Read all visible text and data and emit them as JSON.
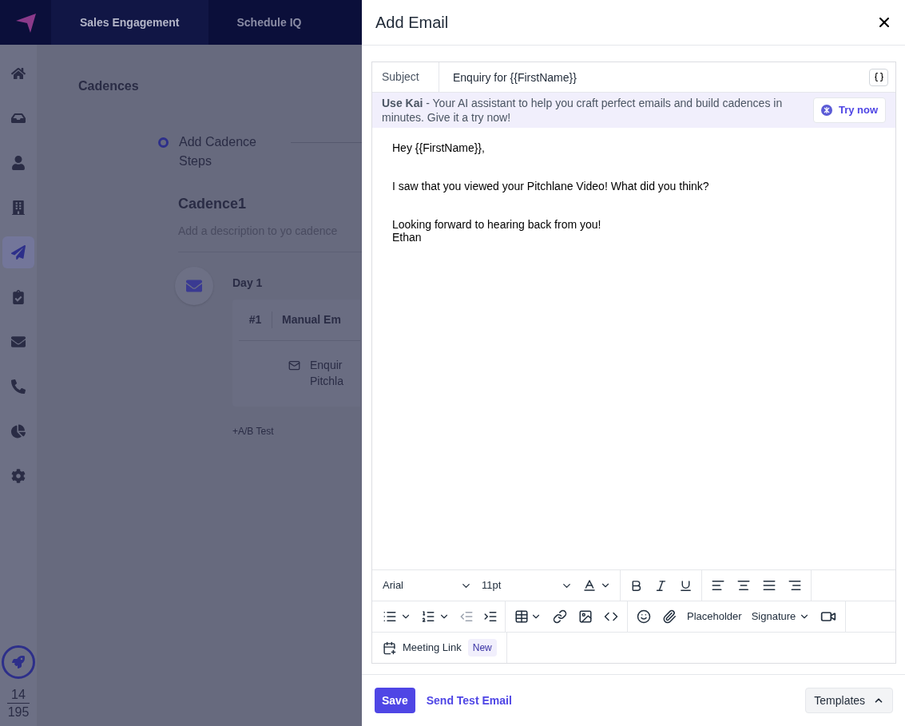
{
  "top_nav": {
    "tabs": [
      {
        "label": "Sales Engagement",
        "selected": true
      },
      {
        "label": "Schedule IQ",
        "selected": false
      }
    ]
  },
  "sidebar": {
    "items": [
      {
        "selected": false
      },
      {
        "selected": false
      },
      {
        "selected": false
      },
      {
        "selected": false
      },
      {
        "selected": true
      },
      {
        "selected": false
      },
      {
        "selected": false
      },
      {
        "selected": false
      },
      {
        "selected": false
      },
      {
        "selected": false
      }
    ],
    "counter": {
      "value": "14",
      "total": "195"
    }
  },
  "page": {
    "title": "Cadences",
    "step": {
      "label": "Add Cadence Steps"
    },
    "cadence_name": "Cadence1",
    "description": "Add a description to yo cadence",
    "day": {
      "label": "Day 1",
      "steps": [
        {
          "number": "#1",
          "type": "Manual Em",
          "subject_lines": [
            "Enquir",
            "Pitchla"
          ]
        }
      ]
    },
    "ab_test": "+A/B Test"
  },
  "drawer": {
    "title": "Add Email",
    "subject": {
      "label": "Subject",
      "value": "Enquiry for {{FirstName}}"
    },
    "kai_banner": {
      "text": "**Use Kai** - Your AI assistant to help you craft perfect emails and build cadences in minutes. Give it a try now!",
      "button": "Try now"
    },
    "body": [
      [
        "Hey {{FirstName}},"
      ],
      [
        "I saw that you viewed your Pitchlane Video! What did you think?"
      ],
      [
        "Looking forward to hearing back from you!",
        "Ethan"
      ]
    ],
    "toolbar": {
      "font": "Arial",
      "size": "11pt",
      "placeholder": "Placeholder",
      "signature": "Signature",
      "meeting_link": "Meeting Link",
      "badge": "New"
    },
    "footer": {
      "save": "Save",
      "send_test": "Send Test Email",
      "templates": "Templates"
    }
  }
}
